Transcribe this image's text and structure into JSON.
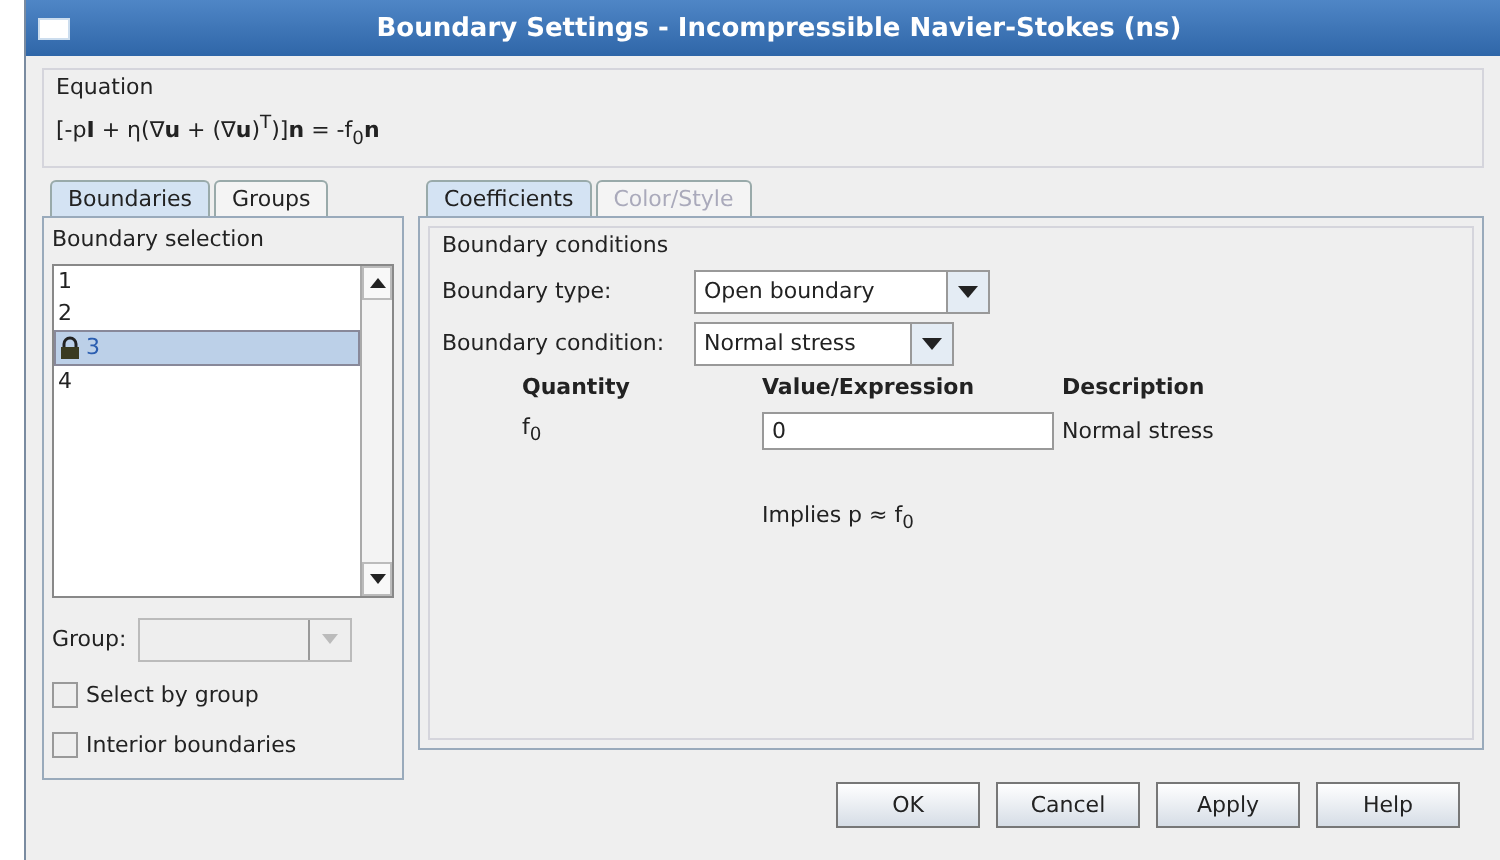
{
  "window": {
    "title": "Boundary Settings - Incompressible Navier-Stokes (ns)"
  },
  "equation": {
    "title": "Equation",
    "formula": "[-p**I** + η(∇**u** + (∇**u**)$^{T}$)]**n** = -f$_{0}$**n**"
  },
  "left_tabs": [
    {
      "label": "Boundaries",
      "selected": true
    },
    {
      "label": "Groups",
      "selected": false
    }
  ],
  "boundary_selection": {
    "title": "Boundary selection",
    "items": [
      {
        "label": "1",
        "selected": false,
        "locked": false
      },
      {
        "label": "2",
        "selected": false,
        "locked": false
      },
      {
        "label": "3",
        "selected": true,
        "locked": true
      },
      {
        "label": "4",
        "selected": false,
        "locked": false
      }
    ]
  },
  "group": {
    "label": "Group:",
    "disabled": true
  },
  "checkboxes": [
    {
      "label": "Select by group",
      "checked": false
    },
    {
      "label": "Interior boundaries",
      "checked": false
    }
  ],
  "right_tabs": [
    {
      "label": "Coefficients",
      "selected": true,
      "disabled": false
    },
    {
      "label": "Color/Style",
      "selected": false,
      "disabled": true
    }
  ],
  "boundary_conditions": {
    "title": "Boundary conditions",
    "boundary_type": {
      "label": "Boundary type:",
      "value": "Open boundary"
    },
    "boundary_condition": {
      "label": "Boundary condition:",
      "value": "Normal stress"
    },
    "columns": [
      "Quantity",
      "Value/Expression",
      "Description"
    ],
    "rows": [
      {
        "quantity": "f$_{0}$",
        "value": "0",
        "description": "Normal stress"
      }
    ],
    "note": "Implies p ≈ f$_{0}$"
  },
  "buttons": [
    "OK",
    "Cancel",
    "Apply",
    "Help"
  ]
}
